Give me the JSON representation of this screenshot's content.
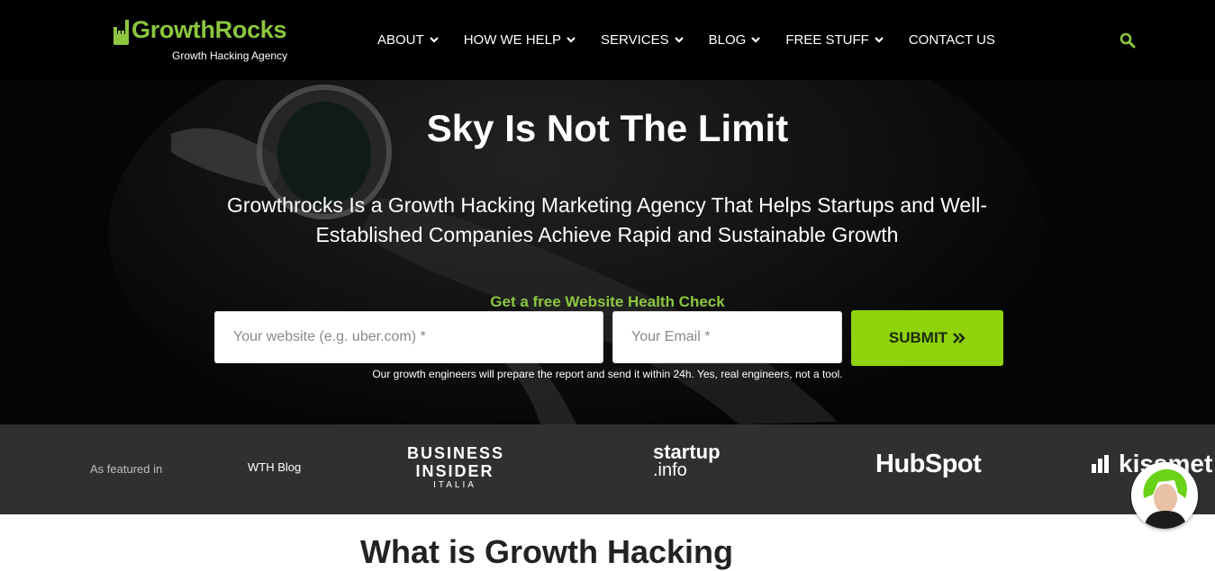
{
  "brand": {
    "name": "GrowthRocks",
    "tagline": "Growth Hacking Agency",
    "accent_color": "#8cc63f",
    "button_color": "#8ed30b"
  },
  "nav": {
    "items": [
      {
        "label": "ABOUT",
        "has_dropdown": true
      },
      {
        "label": "HOW WE HELP",
        "has_dropdown": true
      },
      {
        "label": "SERVICES",
        "has_dropdown": true
      },
      {
        "label": "BLOG",
        "has_dropdown": true
      },
      {
        "label": "FREE STUFF",
        "has_dropdown": true
      },
      {
        "label": "CONTACT US",
        "has_dropdown": false
      }
    ],
    "search_icon": "search-icon"
  },
  "hero": {
    "title": "Sky Is Not The Limit",
    "subtitle": "Growthrocks Is a Growth Hacking Marketing Agency That Helps Startups and Well-Established Companies Achieve Rapid and Sustainable Growth",
    "form": {
      "label": "Get a free Website Health Check",
      "website_placeholder": "Your website (e.g. uber.com) *",
      "email_placeholder": "Your Email *",
      "submit_label": "SUBMIT",
      "note": "Our growth engineers will prepare the report and send it within 24h. Yes, real engineers, not a tool."
    }
  },
  "featured": {
    "label": "As featured in",
    "logos": {
      "wth": "WTH Blog",
      "bi_line1": "BUSINESS",
      "bi_line2": "INSIDER",
      "bi_line3": "ITALIA",
      "startup_line1": "startup",
      "startup_line2": ".info",
      "hubspot": "HubSpot",
      "kissmetrics": "kissmet"
    }
  },
  "next_section_heading_partial": "What is Growth Hacking"
}
